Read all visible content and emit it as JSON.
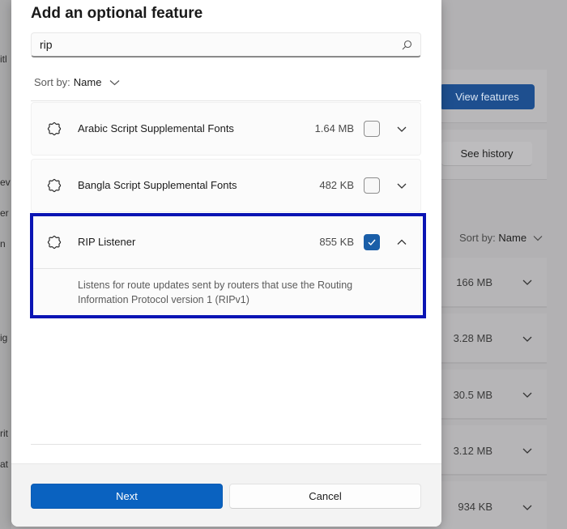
{
  "dialog": {
    "title": "Add an optional feature",
    "search": {
      "value": "rip",
      "placeholder": ""
    },
    "sort": {
      "label": "Sort by:",
      "value": "Name"
    },
    "features": [
      {
        "name": "Arabic Script Supplemental Fonts",
        "size": "1.64 MB",
        "checked": false,
        "expanded": false
      },
      {
        "name": "Bangla Script Supplemental Fonts",
        "size": "482 KB",
        "checked": false,
        "expanded": false
      },
      {
        "name": "RIP Listener",
        "size": "855 KB",
        "checked": true,
        "expanded": true,
        "description": "Listens for route updates sent by routers that use the Routing Information Protocol version 1 (RIPv1)"
      }
    ],
    "buttons": {
      "next": "Next",
      "cancel": "Cancel"
    }
  },
  "background": {
    "left_fragments": [
      "itl",
      "ev",
      "er",
      "n",
      "ig",
      "rit",
      "at"
    ],
    "view_features_label": "View features",
    "see_history_label": "See history",
    "sort": {
      "label": "Sort by:",
      "value": "Name"
    },
    "installed_sizes": [
      "166 MB",
      "3.28 MB",
      "30.5 MB",
      "3.12 MB",
      "934 KB"
    ]
  },
  "colors": {
    "accent": "#0a62c0",
    "highlight_border": "#0a14b4",
    "checkbox_checked": "#1a5ea8"
  }
}
